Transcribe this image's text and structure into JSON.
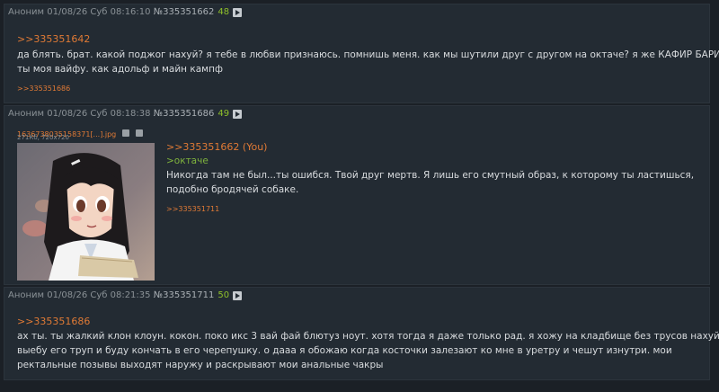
{
  "posts": [
    {
      "author": "Аноним",
      "datetime": "01/08/26 Суб 08:16:10",
      "number": "№335351662",
      "count": "48",
      "reply_ref": ">>335351642",
      "text_line1": "да блять. брат. какой поджог нахуй? я тебе в любви признаюсь. помнишь меня. как мы шутили друг с другом на октаче? я же КАФИР БАРИН.",
      "text_line2": "ты моя вайфу. как адольф и майн кампф",
      "backlink": ">>335351686"
    },
    {
      "author": "Аноним",
      "datetime": "01/08/26 Суб 08:18:38",
      "number": "№335351686",
      "count": "49",
      "file_name": "1636738035158371[...].jpg",
      "file_meta": "271Кб, 720x720",
      "reply_ref": ">>335351662 (You)",
      "greentext": ">октаче",
      "text_line1": "Никогда там не был...ты ошибся. Твой друг мертв. Я лишь его смутный образ, к которому ты ластишься,",
      "text_line2": "подобно бродячей собаке.",
      "backlink": ">>335351711"
    },
    {
      "author": "Аноним",
      "datetime": "01/08/26 Суб 08:21:35",
      "number": "№335351711",
      "count": "50",
      "reply_ref": ">>335351686",
      "text_line1": "ах ты. ты жалкий клон клоун. кокон. поко икс 3 вай фай блютуз ноут. хотя тогда я даже только рад. я хожу на кладбище без трусов нахуй. я",
      "text_line2": "выебу его труп и буду кончать в его черепушку. о дааа я обожаю когда косточки залезают ко мне в уретру и чешут изнутри. мои",
      "text_line3": "ректальные позывы выходят наружу и раскрывают мои анальные чакры"
    }
  ],
  "colors": {
    "background": "#1b2026",
    "post_bg": "#232b33",
    "link": "#e07a35",
    "greentext": "#7fb33d",
    "count": "#8fc02a"
  }
}
